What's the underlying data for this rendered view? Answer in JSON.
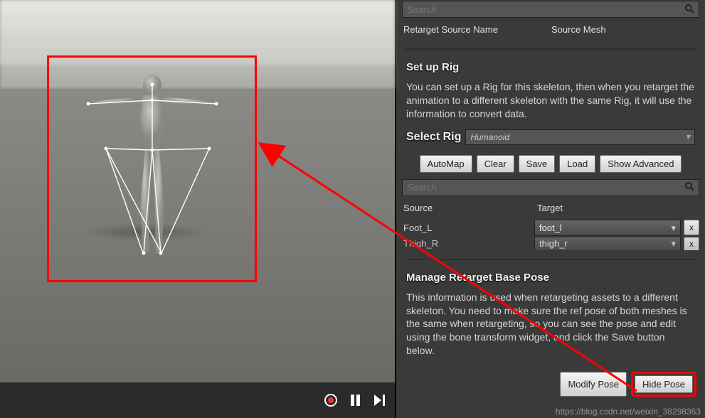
{
  "search": {
    "placeholder": "Search",
    "icon": "magnify"
  },
  "table_headers": {
    "col1": "Retarget Source Name",
    "col2": "Source Mesh"
  },
  "rig_section": {
    "title": "Set up Rig",
    "description": "You can set up a Rig for this skeleton, then when you retarget the animation to a different skeleton with the same Rig, it will use the information to convert data.",
    "select_label": "Select Rig",
    "selected_rig": "Humanoid"
  },
  "rig_buttons": {
    "auto_map": "AutoMap",
    "clear": "Clear",
    "save": "Save",
    "load": "Load",
    "show_advanced": "Show Advanced"
  },
  "mapping_search": {
    "placeholder": "Search"
  },
  "mapping_headers": {
    "source": "Source",
    "target": "Target"
  },
  "mapping_rows": [
    {
      "source": "Foot_L",
      "target": "foot_l"
    },
    {
      "source": "Thigh_R",
      "target": "thigh_r"
    }
  ],
  "pose_section": {
    "title": "Manage Retarget Base Pose",
    "description": "This information is used when retargeting assets to a different skeleton. You need to make sure the ref pose of both meshes is the same when retargeting, so you can see the pose and edit using the bone transform widget, and click the Save button below."
  },
  "pose_buttons": {
    "modify": "Modify Pose",
    "hide": "Hide Pose"
  },
  "watermark": "https://blog.csdn.net/weixin_38298363"
}
